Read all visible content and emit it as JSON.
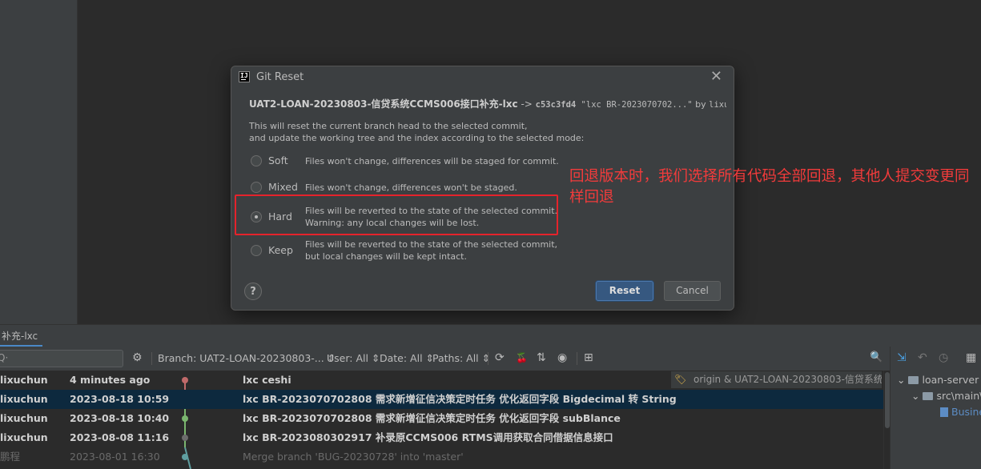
{
  "dialog": {
    "title": "Git Reset",
    "ij_badge": "IJ",
    "close_glyph": "✕",
    "branch": "UAT2-LOAN-20230803-信贷系统CCMS006接口补充-lxc",
    "arrow": " -> ",
    "commit_hash": "c53c3fd4",
    "commit_message": " \"lxc BR-2023070702...\"",
    "by_label": " by ",
    "commit_author": "lixuchun",
    "description_line1": "This will reset the current branch head to the selected commit,",
    "description_line2": "and update the working tree and the index according to the selected mode:",
    "options": [
      {
        "label": "Soft",
        "line1": "Files won't change, differences will be staged for commit.",
        "line2": "",
        "checked": false
      },
      {
        "label": "Mixed",
        "line1": "Files won't change, differences won't be staged.",
        "line2": "",
        "checked": false
      },
      {
        "label": "Hard",
        "line1": "Files will be reverted to the state of the selected commit.",
        "line2": "Warning: any local changes will be lost.",
        "checked": true
      },
      {
        "label": "Keep",
        "line1": "Files will be reverted to the state of the selected commit,",
        "line2": "but local changes will be kept intact.",
        "checked": false
      }
    ],
    "help_label": "?",
    "reset_label": "Reset",
    "cancel_label": "Cancel"
  },
  "annotation": {
    "text": "回退版本时，我们选择所有代码全部回退，其他人提交变更同样回退",
    "color": "#f23b3b"
  },
  "git_panel": {
    "tab_label": "补充-lxc",
    "search_glyph": "Q·",
    "filters": {
      "branch": "Branch: UAT2-LOAN-20230803-... ⇕",
      "user": "User: All ⇕",
      "date": "Date: All ⇕",
      "paths": "Paths: All ⇕"
    },
    "icons": {
      "settings": "⚙",
      "refresh": "⟳",
      "cherry_pick": "🍒",
      "sort": "⇅",
      "eye": "◉",
      "new_tab": "⊞",
      "search": "🔍"
    },
    "commits": [
      {
        "author": "lixuchun",
        "date": "4 minutes ago",
        "message": "lxc ceshi",
        "ref": "origin & UAT2-LOAN-20230803-信贷系统C..."
      },
      {
        "author": "lixuchun",
        "date": "2023-08-18 10:59",
        "message": "lxc BR-2023070702808 需求新增征信决策定时任务 优化返回字段 Bigdecimal 转 String"
      },
      {
        "author": "lixuchun",
        "date": "2023-08-18 10:40",
        "message": "lxc BR-2023070702808 需求新增征信决策定时任务 优化返回字段 subBlance"
      },
      {
        "author": "lixuchun",
        "date": "2023-08-08 11:16",
        "message": "lxc BR-2023080302917 补录原CCMS006 RTMS调用获取合同借据信息接口"
      },
      {
        "author": "鹏程",
        "date": "2023-08-01 16:30",
        "message": "Merge branch 'BUG-20230728' into 'master'"
      }
    ],
    "tree": {
      "root": "loan-server",
      "child": "src\\main\\",
      "file": "Busine"
    },
    "right_icons": {
      "pin": "⇲",
      "undo": "↶",
      "clock": "◷",
      "grid": "▦"
    },
    "graph_colors": {
      "head": "#c06a6a",
      "main": "#7bb66f",
      "merge": "#5f9ea0"
    }
  }
}
